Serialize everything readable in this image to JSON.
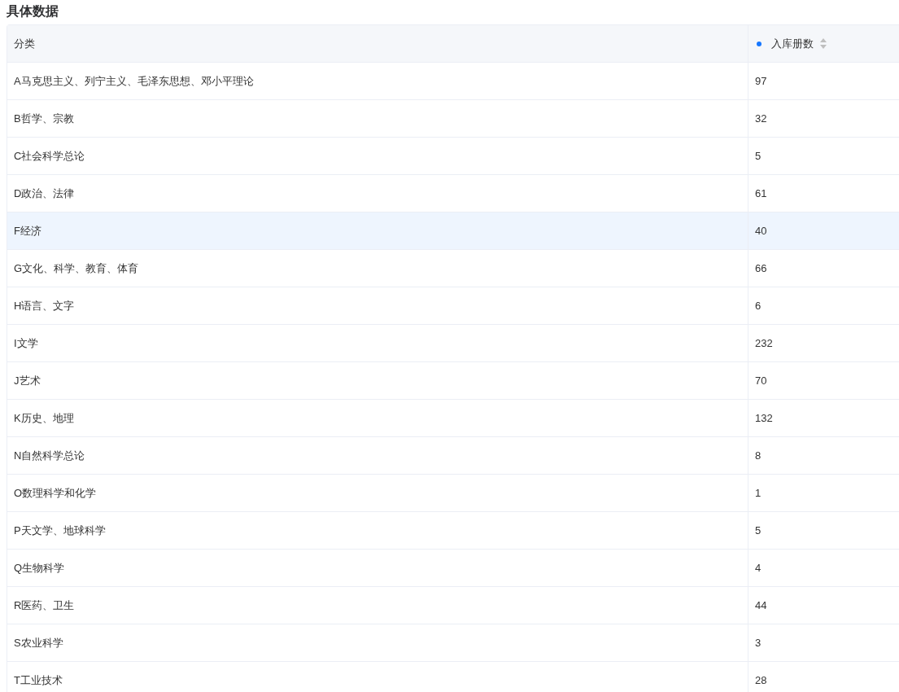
{
  "section_title": "具体数据",
  "table": {
    "columns": [
      {
        "label": "分类",
        "sortable": false,
        "filtered": false
      },
      {
        "label": "入库册数",
        "sortable": true,
        "filtered": true
      }
    ],
    "rows": [
      {
        "category": "A马克思主义、列宁主义、毛泽东思想、邓小平理论",
        "count": "97",
        "selected": false
      },
      {
        "category": "B哲学、宗教",
        "count": "32",
        "selected": false
      },
      {
        "category": "C社会科学总论",
        "count": "5",
        "selected": false
      },
      {
        "category": "D政治、法律",
        "count": "61",
        "selected": false
      },
      {
        "category": "F经济",
        "count": "40",
        "selected": true
      },
      {
        "category": "G文化、科学、教育、体育",
        "count": "66",
        "selected": false
      },
      {
        "category": "H语言、文字",
        "count": "6",
        "selected": false
      },
      {
        "category": "I文学",
        "count": "232",
        "selected": false
      },
      {
        "category": "J艺术",
        "count": "70",
        "selected": false
      },
      {
        "category": "K历史、地理",
        "count": "132",
        "selected": false
      },
      {
        "category": "N自然科学总论",
        "count": "8",
        "selected": false
      },
      {
        "category": "O数理科学和化学",
        "count": "1",
        "selected": false
      },
      {
        "category": "P天文学、地球科学",
        "count": "5",
        "selected": false
      },
      {
        "category": "Q生物科学",
        "count": "4",
        "selected": false
      },
      {
        "category": "R医药、卫生",
        "count": "44",
        "selected": false
      },
      {
        "category": "S农业科学",
        "count": "3",
        "selected": false
      },
      {
        "category": "T工业技术",
        "count": "28",
        "selected": false
      }
    ]
  }
}
